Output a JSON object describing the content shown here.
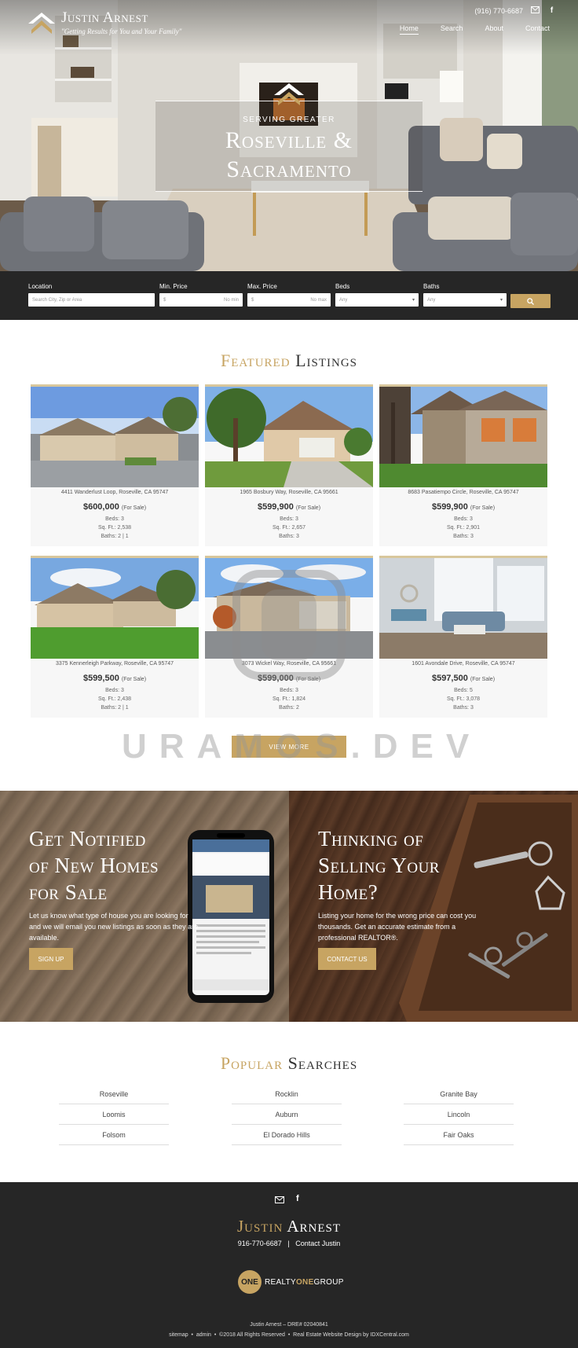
{
  "header": {
    "logo_name": "Justin Arnest",
    "logo_tagline": "\"Getting Results for You and Your Family\"",
    "phone": "(916) 770-6687",
    "nav": [
      "Home",
      "Search",
      "About",
      "Contact"
    ]
  },
  "hero": {
    "subtitle": "SERVING GREATER",
    "title_line1": "Roseville &",
    "title_line2": "Sacramento"
  },
  "search": {
    "location_label": "Location",
    "location_placeholder": "Search City, Zip or Area",
    "min_label": "Min. Price",
    "min_prefix": "$",
    "min_placeholder": "No min",
    "max_label": "Max. Price",
    "max_prefix": "$",
    "max_placeholder": "No max",
    "beds_label": "Beds",
    "beds_value": "Any",
    "baths_label": "Baths",
    "baths_value": "Any"
  },
  "featured": {
    "title_gold": "Featured",
    "title_rest": "Listings",
    "listings": [
      {
        "address": "4411 Wanderlust Loop, Roseville, CA 95747",
        "price": "$600,000",
        "status": "(For Sale)",
        "beds": "Beds: 3",
        "sqft": "Sq. Ft.: 2,538",
        "baths": "Baths: 2 | 1"
      },
      {
        "address": "1965 Bosbury Way, Roseville, CA 95661",
        "price": "$599,900",
        "status": "(For Sale)",
        "beds": "Beds: 3",
        "sqft": "Sq. Ft.: 2,657",
        "baths": "Baths: 3"
      },
      {
        "address": "8683 Pasatiempo Circle, Roseville, CA 95747",
        "price": "$599,900",
        "status": "(For Sale)",
        "beds": "Beds: 3",
        "sqft": "Sq. Ft.: 2,901",
        "baths": "Baths: 3"
      },
      {
        "address": "3375 Kennerleigh Parkway, Roseville, CA 95747",
        "price": "$599,500",
        "status": "(For Sale)",
        "beds": "Beds: 3",
        "sqft": "Sq. Ft.: 2,438",
        "baths": "Baths: 2 | 1"
      },
      {
        "address": "3073 Wickel Way, Roseville, CA 95661",
        "price": "$599,000",
        "status": "(For Sale)",
        "beds": "Beds: 3",
        "sqft": "Sq. Ft.: 1,824",
        "baths": "Baths: 2"
      },
      {
        "address": "1601 Avondale Drive, Roseville, CA 95747",
        "price": "$597,500",
        "status": "(For Sale)",
        "beds": "Beds: 5",
        "sqft": "Sq. Ft.: 3,078",
        "baths": "Baths: 3"
      }
    ],
    "view_more": "VIEW MORE"
  },
  "cta": {
    "notify_title": [
      "Get Notified",
      "of New Homes",
      "for Sale"
    ],
    "notify_text": [
      "Let us know what type of house you are looking for",
      "and we will email you new listings as soon as they are",
      "available."
    ],
    "notify_button": "SIGN UP",
    "sell_title": [
      "Thinking of",
      "Selling Your",
      "Home?"
    ],
    "sell_text": [
      "Listing your home for the wrong price can cost you",
      "thousands. Get an accurate estimate from a",
      "professional REALTOR®."
    ],
    "sell_button": "CONTACT US"
  },
  "popular": {
    "title_gold": "Popular",
    "title_rest": "Searches",
    "items": [
      "Roseville",
      "Rocklin",
      "Granite Bay",
      "Loomis",
      "Auburn",
      "Lincoln",
      "Folsom",
      "El Dorado Hills",
      "Fair Oaks"
    ]
  },
  "footer": {
    "name_first": "Justin",
    "name_last": "Arnest",
    "phone": "916-770-6687",
    "separator": "|",
    "contact_link": "Contact Justin",
    "brand_circle": "ONE",
    "brand_pre": "REALTY",
    "brand_mid": "ONE",
    "brand_post": "GROUP",
    "dre": "Justin Arnest – DRE# 02040841",
    "links": [
      "sitemap",
      "admin",
      "©2018 All Rights Reserved",
      "Real Estate Website Design by IDXCentral.com"
    ],
    "link_sep": "•"
  },
  "watermark": "URAMOS.DEV",
  "colors": {
    "gold": "#c7a462",
    "dark": "#262626"
  }
}
